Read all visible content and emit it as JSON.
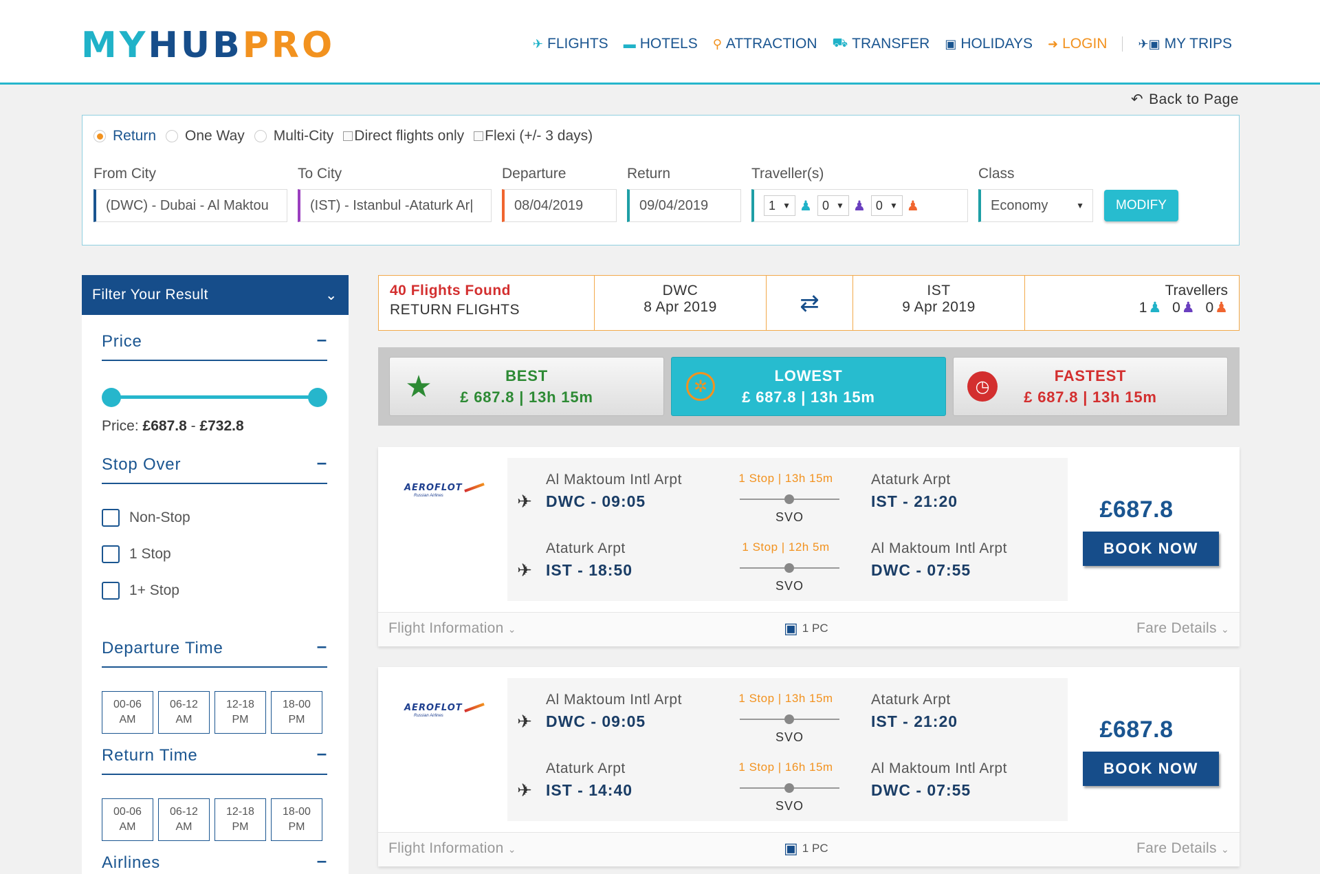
{
  "brand": {
    "logo_my": "MY",
    "logo_hub": "HUB",
    "logo_pro": "PRO"
  },
  "nav": {
    "items": [
      {
        "label": "FLIGHTS",
        "icon": "plane-icon"
      },
      {
        "label": "HOTELS",
        "icon": "bed-icon"
      },
      {
        "label": "ATTRACTION",
        "icon": "binoculars-icon"
      },
      {
        "label": "TRANSFER",
        "icon": "car-icon"
      },
      {
        "label": "HOLIDAYS",
        "icon": "suitcase-icon"
      }
    ],
    "login": "LOGIN",
    "my_trips": "MY TRIPS"
  },
  "back_label": "Back to Page",
  "search": {
    "trip_types": [
      "Return",
      "One Way",
      "Multi-City"
    ],
    "selected_trip_type": "Return",
    "direct_only": "Direct flights only",
    "flexi": "Flexi (+/- 3 days)",
    "labels": {
      "from": "From City",
      "to": "To City",
      "departure": "Departure",
      "return": "Return",
      "travellers": "Traveller(s)",
      "class": "Class"
    },
    "from_value": "(DWC) - Dubai - Al Maktou",
    "to_value": "(IST) - Istanbul -Ataturk Ar|",
    "departure_value": "08/04/2019",
    "return_value": "09/04/2019",
    "adults": "1",
    "children": "0",
    "infants": "0",
    "class_value": "Economy",
    "modify_label": "MODIFY"
  },
  "filter": {
    "title": "Filter Your Result",
    "price_title": "Price",
    "price_label": "Price:",
    "price_min": "£687.8",
    "price_sep": "-",
    "price_max": "£732.8",
    "stop_title": "Stop Over",
    "stops": [
      "Non-Stop",
      "1 Stop",
      "1+ Stop"
    ],
    "departure_title": "Departure Time",
    "return_title": "Return Time",
    "time_slots": [
      {
        "range": "00-06",
        "period": "AM"
      },
      {
        "range": "06-12",
        "period": "AM"
      },
      {
        "range": "12-18",
        "period": "PM"
      },
      {
        "range": "18-00",
        "period": "PM"
      }
    ],
    "airlines_title": "Airlines"
  },
  "summary": {
    "found": "40 Flights Found",
    "type": "RETURN FLIGHTS",
    "origin_code": "DWC",
    "origin_date": "8 Apr 2019",
    "dest_code": "IST",
    "dest_date": "9 Apr 2019",
    "travellers_label": "Travellers",
    "adults": "1",
    "children": "0",
    "infants": "0"
  },
  "sort_tabs": [
    {
      "title": "BEST",
      "detail": "£ 687.8 | 13h 15m",
      "icon": "star-icon"
    },
    {
      "title": "LOWEST",
      "detail": "£ 687.8 | 13h 15m",
      "icon": "coin-icon"
    },
    {
      "title": "FASTEST",
      "detail": "£ 687.8 | 13h 15m",
      "icon": "stopwatch-icon"
    }
  ],
  "flights": [
    {
      "airline": "AEROFLOT",
      "airline_tag": "Russian Airlines",
      "price": "£687.8",
      "book_label": "BOOK NOW",
      "legs": [
        {
          "dep_name": "Al Maktoum Intl Arpt",
          "dep_time": "DWC - 09:05",
          "stop": "1 Stop | 13h 15m",
          "via": "SVO",
          "arr_name": "Ataturk Arpt",
          "arr_time": "IST - 21:20"
        },
        {
          "dep_name": "Ataturk Arpt",
          "dep_time": "IST - 18:50",
          "stop": "1 Stop | 12h 5m",
          "via": "SVO",
          "arr_name": "Al Maktoum Intl Arpt",
          "arr_time": "DWC - 07:55"
        }
      ],
      "flight_info": "Flight Information",
      "baggage": "1 PC",
      "fare_details": "Fare Details"
    },
    {
      "airline": "AEROFLOT",
      "airline_tag": "Russian Airlines",
      "price": "£687.8",
      "book_label": "BOOK NOW",
      "legs": [
        {
          "dep_name": "Al Maktoum Intl Arpt",
          "dep_time": "DWC - 09:05",
          "stop": "1 Stop | 13h 15m",
          "via": "SVO",
          "arr_name": "Ataturk Arpt",
          "arr_time": "IST - 21:20"
        },
        {
          "dep_name": "Ataturk Arpt",
          "dep_time": "IST - 14:40",
          "stop": "1 Stop | 16h 15m",
          "via": "SVO",
          "arr_name": "Al Maktoum Intl Arpt",
          "arr_time": "DWC - 07:55"
        }
      ],
      "flight_info": "Flight Information",
      "baggage": "1 PC",
      "fare_details": "Fare Details"
    }
  ],
  "colors": {
    "brand_teal": "#20b2c8",
    "brand_navy": "#164d8a",
    "brand_orange": "#f2921f"
  }
}
